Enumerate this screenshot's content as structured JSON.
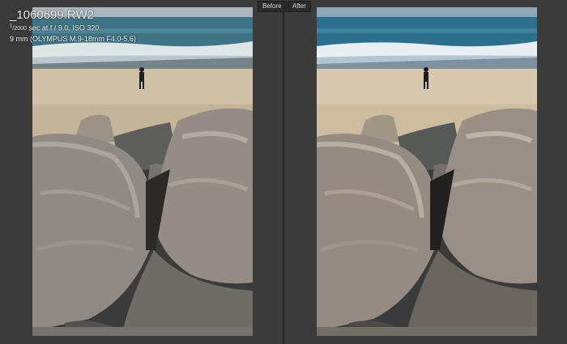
{
  "labels": {
    "before": "Before",
    "after": "After"
  },
  "photo_info": {
    "filename": "_1060699.RW2",
    "shutter_numerator": "1",
    "shutter_denominator": "2000",
    "exposure_rest": "sec at f / 9.0, ISO 320",
    "lens": "9 mm (OLYMPUS M.9-18mm F4.0-5.6)"
  },
  "image": {
    "subject": "beach with rocks and person standing near waves"
  },
  "colors": {
    "panel_background": "#3b3b3b",
    "divider": "#262626",
    "before_sky": "#a9b6bf",
    "after_sky": "#8aa3b5",
    "before_sea": "#3f7486",
    "after_sea": "#2f6f8e"
  }
}
